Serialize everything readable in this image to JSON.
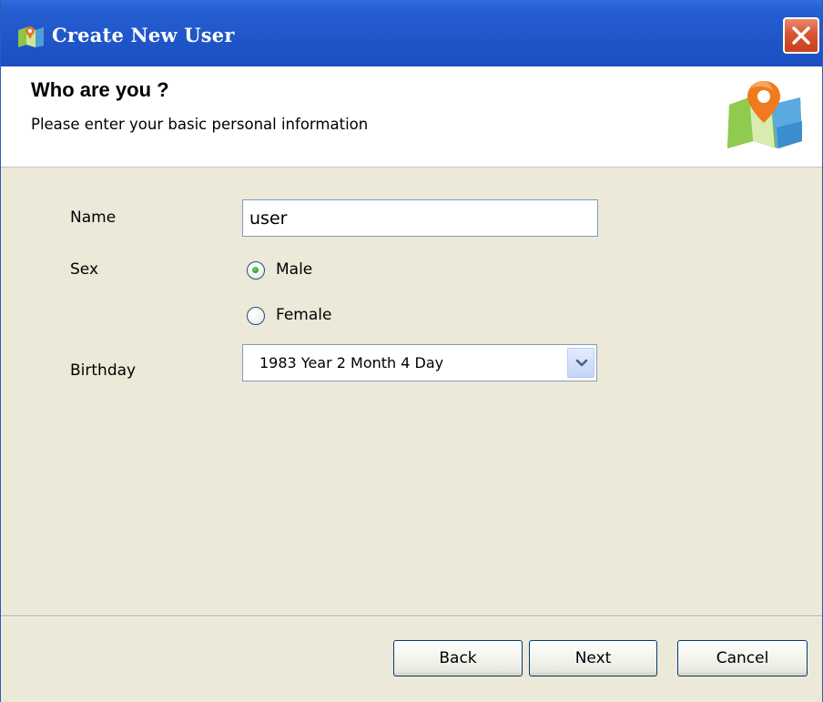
{
  "window": {
    "title": "Create New User",
    "close_label": "close"
  },
  "header": {
    "title": "Who are you ?",
    "subtitle": "Please enter your basic personal information",
    "icon": "map-pin-icon"
  },
  "form": {
    "name_label": "Name",
    "name_value": "user",
    "sex_label": "Sex",
    "sex_options": [
      "Male",
      "Female"
    ],
    "sex_selected": "Male",
    "birthday_label": "Birthday",
    "birthday_value": "1983 Year 2 Month 4 Day"
  },
  "buttons": {
    "back": "Back",
    "next": "Next",
    "cancel": "Cancel"
  },
  "colors": {
    "titlebar": "#2660d4",
    "dialog_bg": "#ece9d8",
    "close_red": "#d8542f",
    "radio_selected": "#2aa12a"
  }
}
